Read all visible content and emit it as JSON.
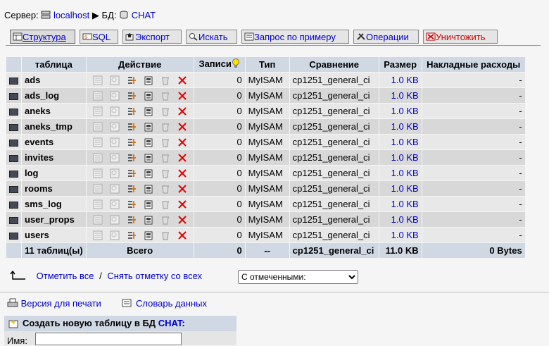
{
  "breadcrumb": {
    "server_label": "Сервер:",
    "server_name": "localhost",
    "sep": "▶",
    "db_label": "БД:",
    "db_name": "CHAT"
  },
  "tabs": [
    {
      "label": "Структура",
      "icon": "structure-icon",
      "active": true
    },
    {
      "label": "SQL",
      "icon": "sql-icon"
    },
    {
      "label": "Экспорт",
      "icon": "export-icon"
    },
    {
      "label": "Искать",
      "icon": "search-icon"
    },
    {
      "label": "Запрос по примеру",
      "icon": "query-icon"
    },
    {
      "label": "Операции",
      "icon": "operations-icon"
    },
    {
      "label": "Уничтожить",
      "icon": "drop-icon"
    }
  ],
  "table": {
    "headers": {
      "table": "таблица",
      "action": "Действие",
      "records": "Записи",
      "type": "Тип",
      "collation": "Сравнение",
      "size": "Размер",
      "overhead": "Накладные расходы"
    },
    "rows": [
      {
        "name": "ads",
        "records": "0",
        "type": "MyISAM",
        "collation": "cp1251_general_ci",
        "size": "1.0 KB",
        "overhead": "-"
      },
      {
        "name": "ads_log",
        "records": "0",
        "type": "MyISAM",
        "collation": "cp1251_general_ci",
        "size": "1.0 KB",
        "overhead": "-"
      },
      {
        "name": "aneks",
        "records": "0",
        "type": "MyISAM",
        "collation": "cp1251_general_ci",
        "size": "1.0 KB",
        "overhead": "-"
      },
      {
        "name": "aneks_tmp",
        "records": "0",
        "type": "MyISAM",
        "collation": "cp1251_general_ci",
        "size": "1.0 KB",
        "overhead": "-"
      },
      {
        "name": "events",
        "records": "0",
        "type": "MyISAM",
        "collation": "cp1251_general_ci",
        "size": "1.0 KB",
        "overhead": "-"
      },
      {
        "name": "invites",
        "records": "0",
        "type": "MyISAM",
        "collation": "cp1251_general_ci",
        "size": "1.0 KB",
        "overhead": "-"
      },
      {
        "name": "log",
        "records": "0",
        "type": "MyISAM",
        "collation": "cp1251_general_ci",
        "size": "1.0 KB",
        "overhead": "-"
      },
      {
        "name": "rooms",
        "records": "0",
        "type": "MyISAM",
        "collation": "cp1251_general_ci",
        "size": "1.0 KB",
        "overhead": "-"
      },
      {
        "name": "sms_log",
        "records": "0",
        "type": "MyISAM",
        "collation": "cp1251_general_ci",
        "size": "1.0 KB",
        "overhead": "-"
      },
      {
        "name": "user_props",
        "records": "0",
        "type": "MyISAM",
        "collation": "cp1251_general_ci",
        "size": "1.0 KB",
        "overhead": "-"
      },
      {
        "name": "users",
        "records": "0",
        "type": "MyISAM",
        "collation": "cp1251_general_ci",
        "size": "1.0 KB",
        "overhead": "-"
      }
    ],
    "footer": {
      "count": "11 таблиц(ы)",
      "total_label": "Всего",
      "records": "0",
      "type": "--",
      "collation": "cp1251_general_ci",
      "size": "11.0 KB",
      "overhead": "0 Bytes"
    },
    "row_actions": [
      "browse-icon",
      "select-icon",
      "insert-icon",
      "properties-icon",
      "empty-icon",
      "drop-icon"
    ]
  },
  "under_table": {
    "check_all": "Отметить все",
    "divider": "/",
    "uncheck_all": "Снять отметку со всех",
    "with_selected": "С отмеченными:"
  },
  "links": {
    "print_view": "Версия для печати",
    "data_dictionary": "Словарь данных"
  },
  "create_table": {
    "title_prefix": "Создать новую таблицу в БД",
    "db_name": "CHAT",
    "title_suffix": ":",
    "name_label": "Имя:",
    "name_value": ""
  },
  "colors": {
    "link": "#0000cc",
    "header_bg": "#d0d8e4",
    "row_odd": "#e8e8e8",
    "row_even": "#d8d8d8",
    "drop_red": "#cc0000"
  }
}
